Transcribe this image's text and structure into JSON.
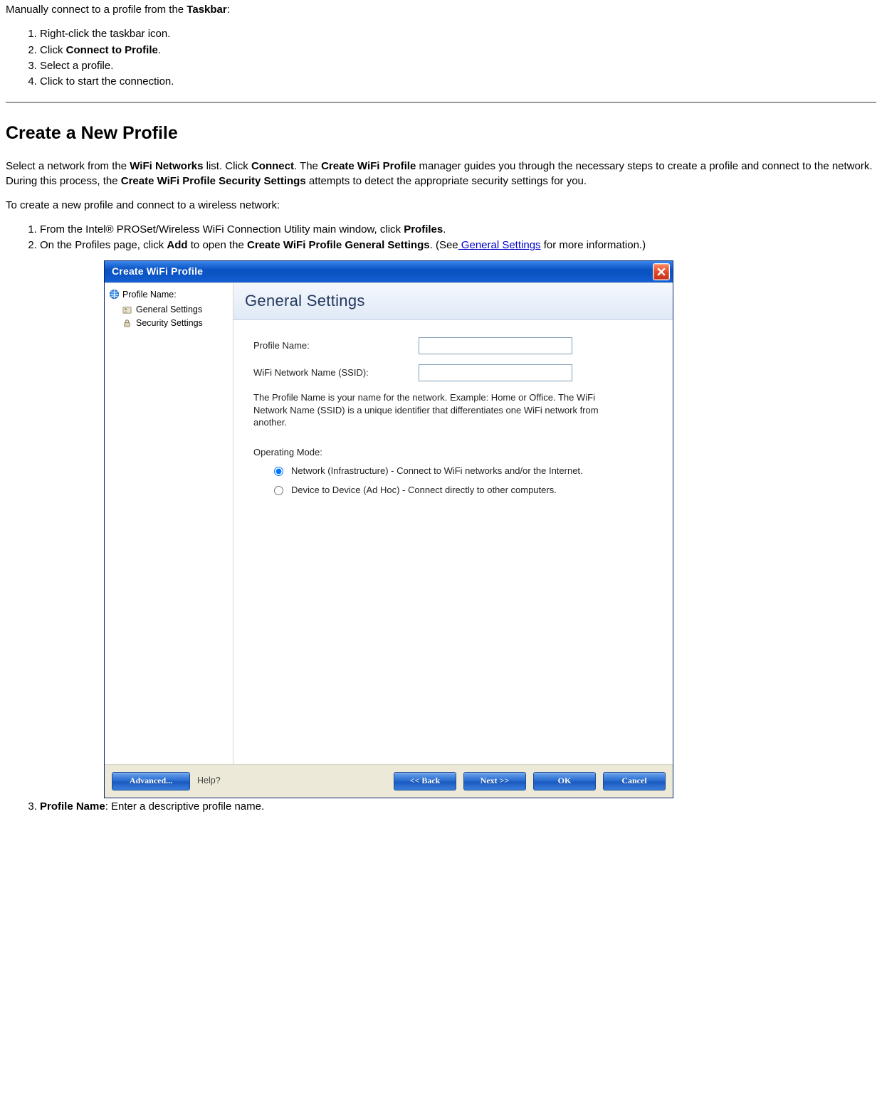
{
  "intro": {
    "taskbar_prefix": "Manually connect to a profile from the ",
    "taskbar_bold": "Taskbar",
    "taskbar_suffix": ":"
  },
  "taskbar_steps": [
    {
      "text": "Right-click the taskbar icon."
    },
    {
      "prefix": "Click ",
      "bold": "Connect to Profile",
      "suffix": "."
    },
    {
      "text": "Select a profile."
    },
    {
      "text": "Click to start the connection."
    }
  ],
  "heading": "Create a New Profile",
  "para1": {
    "p1": "Select a network from the ",
    "b1": "WiFi Networks",
    "p2": " list. Click ",
    "b2": "Connect",
    "p3": ". The ",
    "b3": "Create WiFi Profile",
    "p4": " manager guides you through the necessary steps to create a profile and connect to the network. During this process, the ",
    "b4": "Create WiFi Profile Security Settings",
    "p5": " attempts to detect the appropriate security settings for you."
  },
  "para2": "To create a new profile and connect to a wireless network:",
  "create_steps": {
    "s1": {
      "prefix": "From the Intel® PROSet/Wireless WiFi Connection Utility main window, click ",
      "bold": "Profiles",
      "suffix": "."
    },
    "s2": {
      "p1": "On the Profiles page, click ",
      "b1": "Add",
      "p2": " to open the ",
      "b2": "Create WiFi Profile General Settings",
      "p3": ". (See",
      "link": " General Settings",
      "p4": " for more information.)"
    },
    "s3": {
      "bold": "Profile Name",
      "suffix": ": Enter a descriptive profile name."
    }
  },
  "dialog": {
    "title": "Create WiFi Profile",
    "nav": {
      "root": "Profile Name:",
      "items": [
        "General Settings",
        "Security Settings"
      ]
    },
    "section_title": "General Settings",
    "labels": {
      "profile_name": "Profile Name:",
      "ssid": "WiFi Network Name (SSID):"
    },
    "hint": "The Profile Name is your name for the network. Example: Home or Office. The WiFi Network Name (SSID) is a unique identifier that differentiates one WiFi network from another.",
    "opmode_heading": "Operating Mode:",
    "radios": {
      "infra": "Network (Infrastructure) - Connect to WiFi networks and/or the Internet.",
      "adhoc": "Device to Device (Ad Hoc) - Connect directly to other computers."
    },
    "buttons": {
      "advanced": "Advanced...",
      "help": "Help?",
      "back": "<< Back",
      "next": "Next >>",
      "ok": "OK",
      "cancel": "Cancel"
    }
  }
}
